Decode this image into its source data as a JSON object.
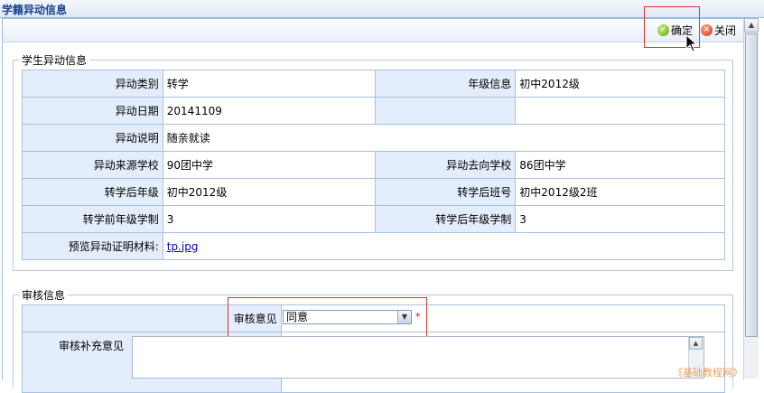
{
  "window": {
    "title": "学籍异动信息"
  },
  "toolbar": {
    "confirm_label": "确定",
    "close_label": "关闭"
  },
  "student_section": {
    "legend": "学生异动信息",
    "rows": [
      {
        "l1": "异动类别",
        "v1": "转学",
        "l2": "年级信息",
        "v2": "初中2012级"
      },
      {
        "l1": "异动日期",
        "v1": "20141109",
        "l2": "",
        "v2": ""
      },
      {
        "l1": "异动说明",
        "v1": "随亲就读"
      },
      {
        "l1": "异动来源学校",
        "v1": "90团中学",
        "l2": "异动去向学校",
        "v2": "86团中学"
      },
      {
        "l1": "转学后年级",
        "v1": "初中2012级",
        "l2": "转学后班号",
        "v2": "初中2012级2班"
      },
      {
        "l1": "转学前年级学制",
        "v1": "3",
        "l2": "转学后年级学制",
        "v2": "3"
      },
      {
        "l1": "预览异动证明材料:",
        "v1": "tp.jpg"
      }
    ]
  },
  "review_section": {
    "legend": "审核信息",
    "opinion_label": "审核意见",
    "opinion_value": "同意",
    "required_mark": "*",
    "supplement_label": "审核补充意见",
    "supplement_value": ""
  },
  "watermark": "《基础教程网》",
  "colors": {
    "label_bg": "#e3edfb",
    "border": "#a9c0de",
    "highlight": "#e0302a",
    "title": "#15428b"
  },
  "icons": {
    "confirm": "check-circle-icon",
    "close": "x-circle-icon",
    "cursor": "pointer-cursor-icon"
  }
}
